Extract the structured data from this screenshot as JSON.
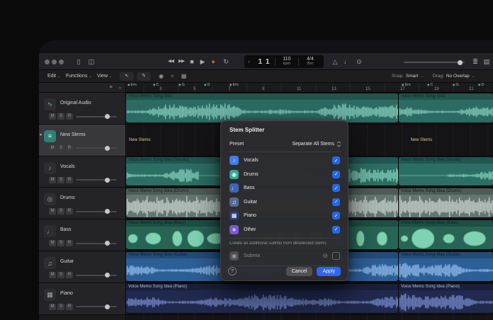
{
  "glyphs": {
    "chevron_down": "⌄",
    "disclosure": "▾",
    "check": "✓",
    "chord_marker": "◆",
    "minus_circle": "⊖"
  },
  "window": {
    "controls": [
      "close",
      "minimize",
      "zoom"
    ]
  },
  "control_bar": {
    "left_icons": [
      {
        "name": "library-toggle",
        "glyph": "▯"
      },
      {
        "name": "inspector-toggle",
        "glyph": "◫"
      }
    ],
    "transport": [
      {
        "name": "rewind",
        "glyph": "◀◀"
      },
      {
        "name": "forward",
        "glyph": "▶▶"
      },
      {
        "name": "stop",
        "glyph": "■"
      },
      {
        "name": "play",
        "glyph": "▶"
      },
      {
        "name": "record",
        "glyph": "●",
        "color": "#e0504e"
      },
      {
        "name": "cycle",
        "glyph": "↻"
      }
    ],
    "lcd": {
      "note_icon": "♪",
      "position": "1 1",
      "tempo_value": "110",
      "tempo_unit": "bpm",
      "time_sig": "4/4",
      "key": "Bm"
    },
    "mid_icons": [
      {
        "name": "metronome",
        "glyph": "△"
      },
      {
        "name": "count-in",
        "glyph": "♩"
      },
      {
        "name": "tuner",
        "glyph": "⊙"
      }
    ],
    "right_icons": [
      {
        "name": "list-editors",
        "glyph": "≣"
      },
      {
        "name": "browsers",
        "glyph": "▤"
      }
    ]
  },
  "toolbar": {
    "menus": [
      "Edit",
      "Functions",
      "View"
    ],
    "tools": [
      {
        "name": "pointer-tool",
        "glyph": "↖"
      },
      {
        "name": "pencil-tool",
        "glyph": "✎"
      }
    ],
    "toggles": [
      {
        "name": "automation-toggle",
        "glyph": "◉"
      },
      {
        "name": "flex-toggle",
        "glyph": "≈"
      },
      {
        "name": "grid-toggle",
        "glyph": "▦"
      }
    ],
    "snap_label": "Snap:",
    "snap_value": "Smart",
    "drag_label": "Drag:",
    "drag_value": "No Overlap"
  },
  "track_panel": {
    "top_icons": [
      {
        "name": "global-tracks-toggle",
        "glyph": "≡"
      },
      {
        "name": "track-options",
        "glyph": "⌄"
      }
    ],
    "buttons": {
      "mute": "M",
      "solo": "S",
      "record": "R"
    }
  },
  "tracks": [
    {
      "name": "Original Audio",
      "glyph": "∿",
      "icon_bg": "#2e2e32",
      "icon_color": "#63c2ae",
      "selected": false
    },
    {
      "name": "New Stems",
      "glyph": "≡",
      "icon_bg": "#2f8172",
      "icon_color": "#e0f5ee",
      "selected": true
    },
    {
      "name": "Vocals",
      "glyph": "♪",
      "icon_bg": "#2e2e32",
      "icon_color": "#9fa8ad",
      "selected": false
    },
    {
      "name": "Drums",
      "glyph": "◎",
      "icon_bg": "#2e2e32",
      "icon_color": "#9fa8ad",
      "selected": false
    },
    {
      "name": "Bass",
      "glyph": "♩",
      "icon_bg": "#2e2e32",
      "icon_color": "#9fa8ad",
      "selected": false
    },
    {
      "name": "Guitar",
      "glyph": "♫",
      "icon_bg": "#2e2e32",
      "icon_color": "#9fa8ad",
      "selected": false
    },
    {
      "name": "Piano",
      "glyph": "▦",
      "icon_bg": "#2e2e32",
      "icon_color": "#9fa8ad",
      "selected": false
    }
  ],
  "ruler": {
    "bars": [
      "3",
      "5",
      "7",
      "9",
      "11",
      "13",
      "15",
      "17",
      "19",
      "21"
    ],
    "chords": [
      "Em",
      "C",
      "G",
      "D",
      "Em",
      "Em",
      "C",
      "G",
      "D"
    ]
  },
  "lanes": [
    {
      "region_label": "Voice Memo Song Idea",
      "body": "#2b6b62",
      "head": "#21544c",
      "wave": "#8ed7c6",
      "text": "#0d2925",
      "style": "dense"
    },
    {
      "region_label": "New Stems",
      "body": "#1b211f",
      "head": "#1b211f",
      "wave": "",
      "text": "#d5d291",
      "style": "none"
    },
    {
      "region_label": "Voice Memo Song Idea (Vocals)",
      "body": "#2b6e63",
      "head": "#215650",
      "wave": "#90dac8",
      "text": "#0d2925",
      "style": "vocal"
    },
    {
      "region_label": "Voice Memo Song Idea (Drums)",
      "body": "#64746e",
      "head": "#4e5c57",
      "wave": "#d2ded9",
      "text": "#141b18",
      "style": "drums"
    },
    {
      "region_label": "Voice Memo Song Idea (Bass)",
      "body": "#276454",
      "head": "#1d4f42",
      "wave": "#7fd3b2",
      "text": "#0b241d",
      "style": "blob"
    },
    {
      "region_label": "Voice Memo Song Idea (Guitar)",
      "body": "#2d5f97",
      "head": "#234b78",
      "wave": "#9ac4f2",
      "text": "#0d1f38",
      "style": "dense"
    },
    {
      "region_label": "Voice Memo Song Idea (Piano)",
      "body": "#20294e",
      "head": "#19203d",
      "wave": "#7f93d6",
      "text": "#aebadf",
      "style": "dense"
    }
  ],
  "dialog": {
    "title": "Stem Splitter",
    "preset_label": "Preset",
    "preset_value": "Separate All Stems",
    "stems": [
      {
        "label": "Vocals",
        "glyph": "♪",
        "color": "#3e7ee6",
        "checked": true
      },
      {
        "label": "Drums",
        "glyph": "◉",
        "color": "#35a79a",
        "checked": true
      },
      {
        "label": "Bass",
        "glyph": "♩",
        "color": "#3f66b5",
        "checked": true
      },
      {
        "label": "Guitar",
        "glyph": "♫",
        "color": "#566b91",
        "checked": true
      },
      {
        "label": "Piano",
        "glyph": "▦",
        "color": "#2c3d77",
        "checked": true
      },
      {
        "label": "Other",
        "glyph": "∗",
        "color": "#7a58d8",
        "checked": true
      }
    ],
    "submix_note": "Create an additional submix from deselected stems:",
    "submix_label": "Submix",
    "submix_icon_glyph": "▣",
    "help_label": "?",
    "cancel_label": "Cancel",
    "apply_label": "Apply",
    "accent_color": "#2e66f0",
    "checkbox_color": "#2567e8"
  }
}
